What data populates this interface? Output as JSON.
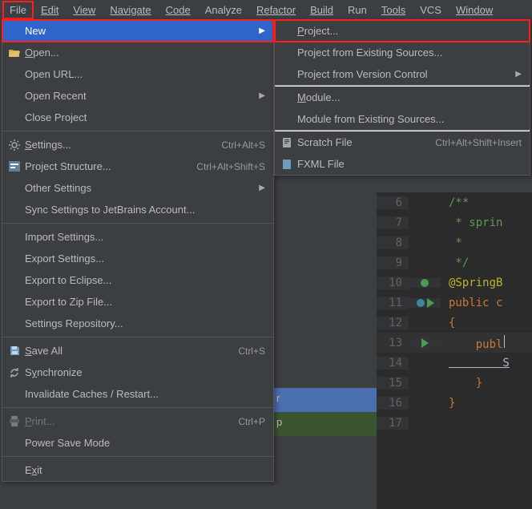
{
  "menubar": {
    "items": [
      {
        "label": "File",
        "underline": 0
      },
      {
        "label": "Edit",
        "underline": 0
      },
      {
        "label": "View",
        "underline": 0
      },
      {
        "label": "Navigate",
        "underline": 0
      },
      {
        "label": "Code",
        "underline": 0
      },
      {
        "label": "Analyze",
        "underline": -1
      },
      {
        "label": "Refactor",
        "underline": 0
      },
      {
        "label": "Build",
        "underline": 0
      },
      {
        "label": "Run",
        "underline": 1
      },
      {
        "label": "Tools",
        "underline": 0
      },
      {
        "label": "VCS",
        "underline": 2
      },
      {
        "label": "Window",
        "underline": 0
      }
    ]
  },
  "file_menu": {
    "new": {
      "label": "New"
    },
    "open": {
      "label": "Open..."
    },
    "open_url": {
      "label": "Open URL..."
    },
    "open_recent": {
      "label": "Open Recent"
    },
    "close_proj": {
      "label": "Close Project"
    },
    "settings": {
      "label": "Settings...",
      "shortcut": "Ctrl+Alt+S"
    },
    "proj_struct": {
      "label": "Project Structure...",
      "shortcut": "Ctrl+Alt+Shift+S"
    },
    "other_set": {
      "label": "Other Settings"
    },
    "sync_set": {
      "label": "Sync Settings to JetBrains Account..."
    },
    "import_set": {
      "label": "Import Settings..."
    },
    "export_set": {
      "label": "Export Settings..."
    },
    "export_ecl": {
      "label": "Export to Eclipse..."
    },
    "export_zip": {
      "label": "Export to Zip File..."
    },
    "set_repo": {
      "label": "Settings Repository..."
    },
    "save_all": {
      "label": "Save All",
      "shortcut": "Ctrl+S"
    },
    "sync": {
      "label": "Synchronize"
    },
    "invalidate": {
      "label": "Invalidate Caches / Restart..."
    },
    "print": {
      "label": "Print...",
      "shortcut": "Ctrl+P"
    },
    "power_save": {
      "label": "Power Save Mode"
    },
    "exit": {
      "label": "Exit"
    }
  },
  "new_submenu": {
    "project": {
      "label": "Project..."
    },
    "proj_existing": {
      "label": "Project from Existing Sources..."
    },
    "proj_vcs": {
      "label": "Project from Version Control"
    },
    "module": {
      "label": "Module..."
    },
    "mod_existing": {
      "label": "Module from Existing Sources..."
    },
    "scratch": {
      "label": "Scratch File",
      "shortcut": "Ctrl+Alt+Shift+Insert"
    },
    "fxml": {
      "label": "FXML File"
    }
  },
  "editor": {
    "lines": [
      {
        "n": "6",
        "code": "/**",
        "cls": "tok-doc"
      },
      {
        "n": "7",
        "code": " * sprin",
        "cls": "tok-doc"
      },
      {
        "n": "8",
        "code": " *",
        "cls": "tok-doc"
      },
      {
        "n": "9",
        "code": " */",
        "cls": "tok-doc"
      },
      {
        "n": "10",
        "code": "@SpringB",
        "cls": "tok-ann",
        "gutter": "run1"
      },
      {
        "n": "11",
        "code": "public c",
        "cls": "tok-kw",
        "gutter": "run2"
      },
      {
        "n": "12",
        "code": "{",
        "cls": "tok-br"
      },
      {
        "n": "13",
        "code": "    publ",
        "cls": "tok-kw",
        "gutter": "play",
        "cur": true
      },
      {
        "n": "14",
        "code": "        S",
        "cls": ""
      },
      {
        "n": "15",
        "code": "    }",
        "cls": "tok-br"
      },
      {
        "n": "16",
        "code": "}",
        "cls": "tok-br"
      },
      {
        "n": "17",
        "code": "",
        "cls": ""
      }
    ]
  },
  "bg": {
    "r_letter": "r",
    "p_letter": "p"
  }
}
